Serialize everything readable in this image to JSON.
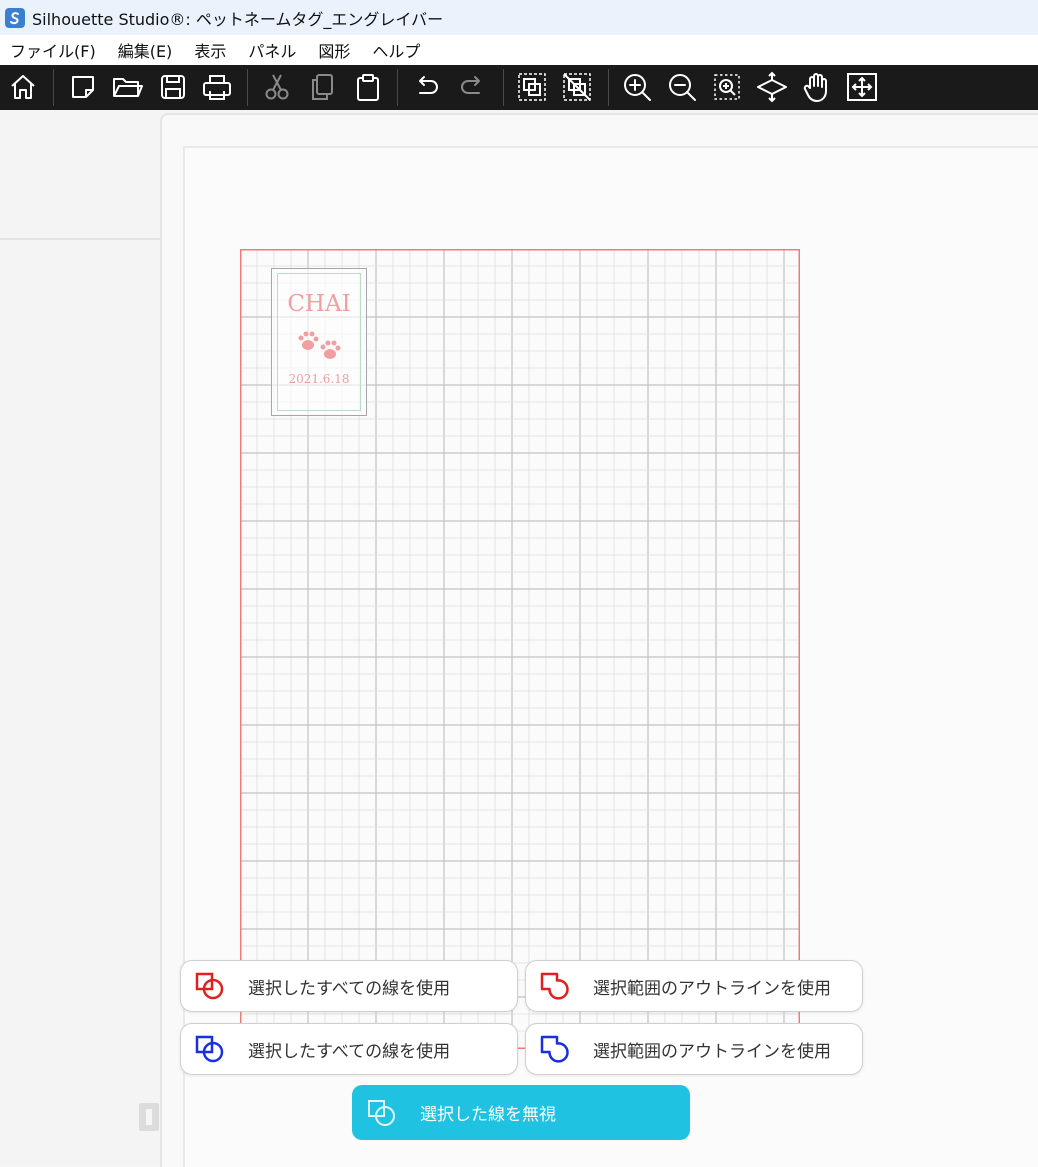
{
  "window": {
    "title": "Silhouette Studio®: ペットネームタグ_エングレイバー"
  },
  "menu": {
    "items": [
      "ファイル(F)",
      "編集(E)",
      "表示",
      "パネル",
      "図形",
      "ヘルプ"
    ]
  },
  "toolbar": {
    "icons": [
      "home-icon",
      "new-document-icon",
      "open-folder-icon",
      "save-icon",
      "print-icon",
      "cut-icon",
      "copy-icon",
      "paste-icon",
      "undo-icon",
      "redo-icon",
      "group-icon",
      "ungroup-icon",
      "zoom-in-icon",
      "zoom-out-icon",
      "zoom-selection-icon",
      "pan-view-icon",
      "hand-icon",
      "fit-to-page-icon"
    ]
  },
  "design": {
    "name": "CHAI",
    "date": "2021.6.18",
    "text_color": "#f29da0",
    "border_color": "#b8dcc6"
  },
  "mat": {
    "border_color": "#f07b7b",
    "grid_color": "#d0d0d0"
  },
  "options": {
    "red_all_lines": "選択したすべての線を使用",
    "red_outline": "選択範囲のアウトラインを使用",
    "blue_all_lines": "選択したすべての線を使用",
    "blue_outline": "選択範囲のアウトラインを使用",
    "ignore_lines": "選択した線を無視"
  },
  "colors": {
    "red": "#e02020",
    "blue": "#1a2fe0",
    "primary": "#1fc2e0"
  }
}
